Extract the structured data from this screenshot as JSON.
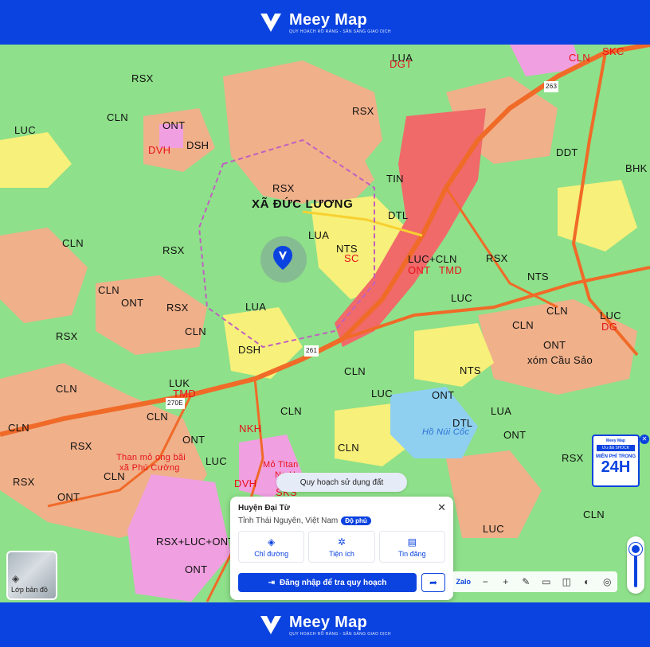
{
  "brand": {
    "name": "Meey Map",
    "tagline": "QUY HOẠCH RÕ RÀNG - SẴN SÀNG GIAO DỊCH"
  },
  "map_labels": [
    {
      "text": "RSX",
      "color": "black"
    },
    {
      "text": "CLN",
      "color": "black"
    },
    {
      "text": "LUA",
      "color": "black"
    },
    {
      "text": "DGT",
      "color": "red"
    },
    {
      "text": "CLN",
      "color": "red"
    },
    {
      "text": "SKC",
      "color": "red"
    },
    {
      "text": "ONT",
      "color": "black"
    },
    {
      "text": "LUC",
      "color": "black"
    },
    {
      "text": "DVH",
      "color": "red"
    },
    {
      "text": "DSH",
      "color": "black"
    },
    {
      "text": "RSX",
      "color": "black"
    },
    {
      "text": "DDT",
      "color": "black"
    },
    {
      "text": "BHK",
      "color": "black"
    },
    {
      "text": "TIN",
      "color": "black"
    },
    {
      "text": "NTS",
      "color": "black"
    },
    {
      "text": "SC",
      "color": "red"
    },
    {
      "text": "DTL",
      "color": "black"
    },
    {
      "text": "LUC+CLN",
      "color": "black"
    },
    {
      "text": "ONT",
      "color": "red"
    },
    {
      "text": "TMD",
      "color": "red"
    },
    {
      "text": "DSH",
      "color": "black"
    },
    {
      "text": "LUK",
      "color": "black"
    },
    {
      "text": "TMD",
      "color": "red"
    },
    {
      "text": "NKH",
      "color": "red"
    },
    {
      "text": "SKS",
      "color": "red"
    },
    {
      "text": "DVH",
      "color": "red"
    },
    {
      "text": "RSX+LUC+ONT",
      "color": "black"
    },
    {
      "text": "LUC",
      "color": "black"
    },
    {
      "text": "DG",
      "color": "red"
    },
    {
      "text": "DTL",
      "color": "black"
    }
  ],
  "place_names": {
    "commune": "XÃ ĐỨC LƯƠNG",
    "hamlet": "xóm Cầu Sảo",
    "mine": "Mỏ Titan",
    "mine_sub": "Na Hoa",
    "quarry": "Than mỏ ong bãi",
    "quarry_sub": "xã Phú Cường",
    "lake": "Hồ Núi Cốc"
  },
  "road_labels": [
    "263",
    "270E",
    "261"
  ],
  "layer_button": {
    "label": "Lớp bản đồ",
    "icon": "layers-icon"
  },
  "mode_chip": {
    "label": "Quy hoạch sử dụng đất"
  },
  "info_card": {
    "title": "Huyện Đại Từ",
    "location": "Tỉnh Thái Nguyên, Việt Nam",
    "badge": "Độ phủ",
    "actions": [
      {
        "label": "Chỉ đường",
        "icon": "directions-icon"
      },
      {
        "label": "Tiện ích",
        "icon": "utilities-icon"
      },
      {
        "label": "Tin đăng",
        "icon": "listings-icon"
      }
    ],
    "login_label": "Đăng nhập để tra quy hoạch",
    "close_icon": "close-icon",
    "share_icon": "share-icon"
  },
  "toolbar": {
    "zalo_label": "Zalo",
    "buttons": [
      "zoom-out-icon",
      "zoom-in-icon",
      "draw-icon",
      "ruler-icon",
      "split-icon",
      "opacity-icon",
      "locate-icon"
    ]
  },
  "ad": {
    "brand": "Meey Map",
    "promo": "Ưu đãi SHOCK",
    "line1": "MIỄN PHÍ TRONG",
    "line2": "24H"
  },
  "colors": {
    "brand": "#0b43e0",
    "forest": "#8ee08a",
    "residential": "#f0b08a",
    "rice": "#f7f07a",
    "industrial": "#f0a0e0",
    "road": "#f06a28"
  }
}
